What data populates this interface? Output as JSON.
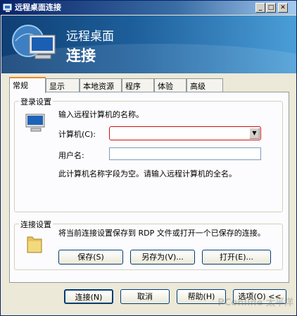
{
  "window": {
    "title": "远程桌面连接",
    "min_glyph": "_",
    "max_glyph": "□",
    "close_glyph": "✕"
  },
  "banner": {
    "line1": "远程桌面",
    "line2": "连接"
  },
  "tabs": [
    {
      "label": "常规",
      "active": true
    },
    {
      "label": "显示",
      "active": false
    },
    {
      "label": "本地资源",
      "active": false
    },
    {
      "label": "程序",
      "active": false
    },
    {
      "label": "体验",
      "active": false
    },
    {
      "label": "高级",
      "active": false
    }
  ],
  "logon": {
    "legend": "登录设置",
    "prompt": "输入远程计算机的名称。",
    "computer_label": "计算机(C):",
    "computer_value": "",
    "username_label": "用户名:",
    "username_value": "",
    "message": "此计算机名称字段为空。请输入远程计算机的全名。"
  },
  "connection": {
    "legend": "连接设置",
    "description": "将当前连接设置保存到 RDP 文件或打开一个已保存的连接。",
    "save_label": "保存(S)",
    "save_as_label": "另存为(V)...",
    "open_label": "打开(E)..."
  },
  "footer": {
    "connect_label": "连接(N)",
    "cancel_label": "取消",
    "help_label": "帮助(H)",
    "options_label": "选项(O) <<"
  },
  "watermark": "PConline 太平洋"
}
